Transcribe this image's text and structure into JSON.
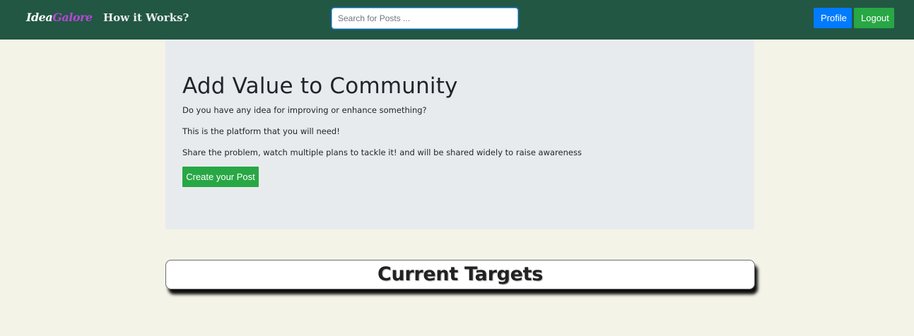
{
  "navbar": {
    "brand_part1": "Idea",
    "brand_part2": "Galore",
    "how_it_works": "How it Works?",
    "search_placeholder": "Search for Posts ...",
    "profile_label": "Profile",
    "logout_label": "Logout",
    "colors": {
      "background": "#225743",
      "brand_accent": "#b845d8",
      "profile_button": "#007bff",
      "logout_button": "#28a745"
    }
  },
  "hero": {
    "title": "Add Value to Community",
    "line1": "Do you have any idea for improving or enhance something?",
    "line2": "This is the platform that you will need!",
    "line3": "Share the problem, watch multiple plans to tackle it! and will be shared widely to raise awareness",
    "create_button": "Create your Post"
  },
  "targets": {
    "heading": "Current Targets"
  },
  "page": {
    "background": "#f4f3e7"
  }
}
